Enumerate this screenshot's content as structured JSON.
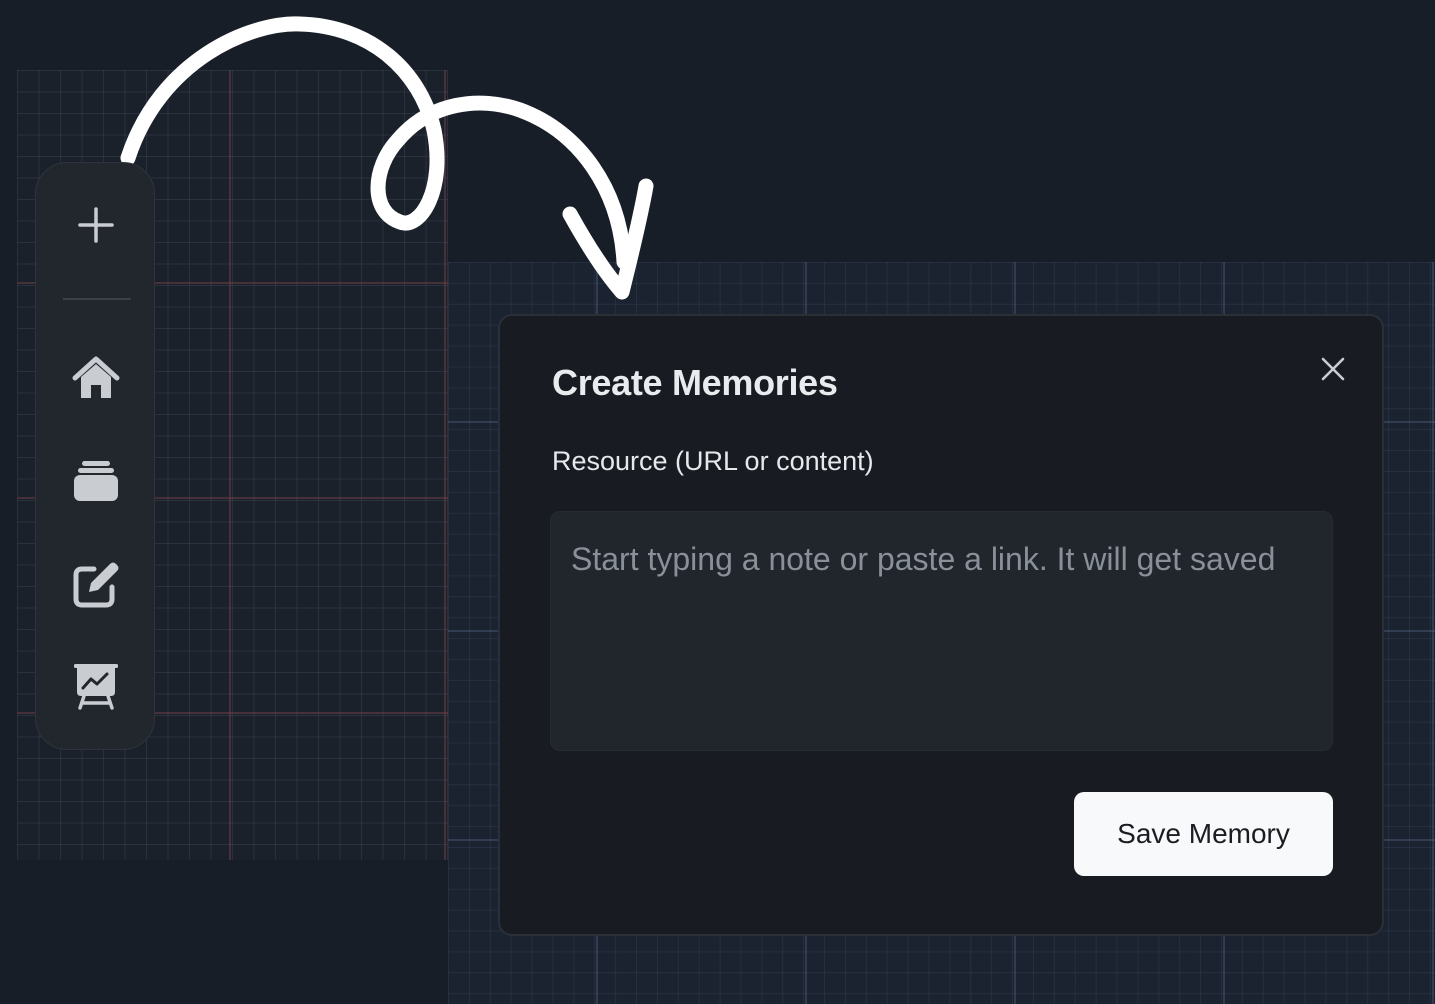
{
  "sidebar": {
    "items": [
      {
        "name": "add",
        "icon": "plus-icon"
      },
      {
        "name": "home",
        "icon": "home-icon"
      },
      {
        "name": "memories",
        "icon": "stack-icon"
      },
      {
        "name": "notes",
        "icon": "edit-icon"
      },
      {
        "name": "canvas",
        "icon": "presentation-chart-icon"
      }
    ]
  },
  "modal": {
    "title": "Create Memories",
    "close_icon": "close-icon",
    "field_label": "Resource (URL or content)",
    "textarea": {
      "value": "",
      "placeholder": "Start typing a note or paste a link. It will get saved"
    },
    "save_label": "Save Memory"
  },
  "colors": {
    "background": "#181e27",
    "sidebar": "#22272e",
    "modal": "#181c22",
    "textarea": "#21262d",
    "button": "#f8f9fa",
    "icon": "#c9ccd1",
    "arrow": "#ffffff"
  }
}
